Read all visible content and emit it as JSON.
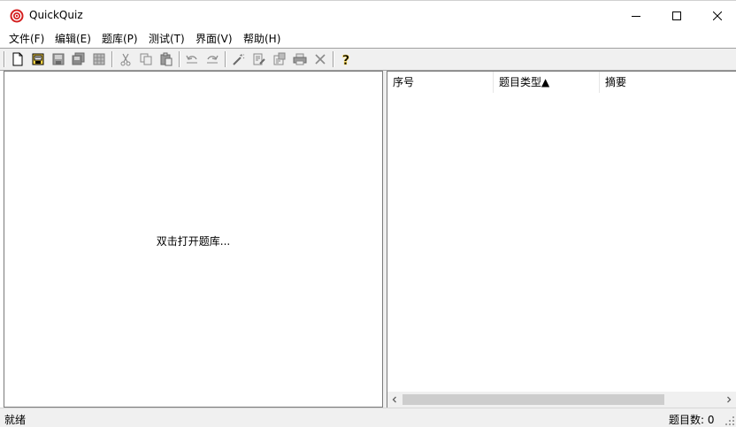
{
  "window": {
    "title": "QuickQuiz"
  },
  "menu": {
    "file": "文件(F)",
    "edit": "编辑(E)",
    "bank": "题库(P)",
    "test": "测试(T)",
    "ui": "界面(V)",
    "help": "帮助(H)"
  },
  "left_pane": {
    "hint": "双击打开题库..."
  },
  "list": {
    "columns": [
      "序号",
      "题目类型▲",
      "摘要"
    ]
  },
  "status": {
    "left": "就绪",
    "right": "题目数: 0"
  },
  "colors": {
    "toolbar_bg": "#f0f0f0",
    "border": "#7a7a7a",
    "scroll_thumb": "#cdcdcd"
  }
}
